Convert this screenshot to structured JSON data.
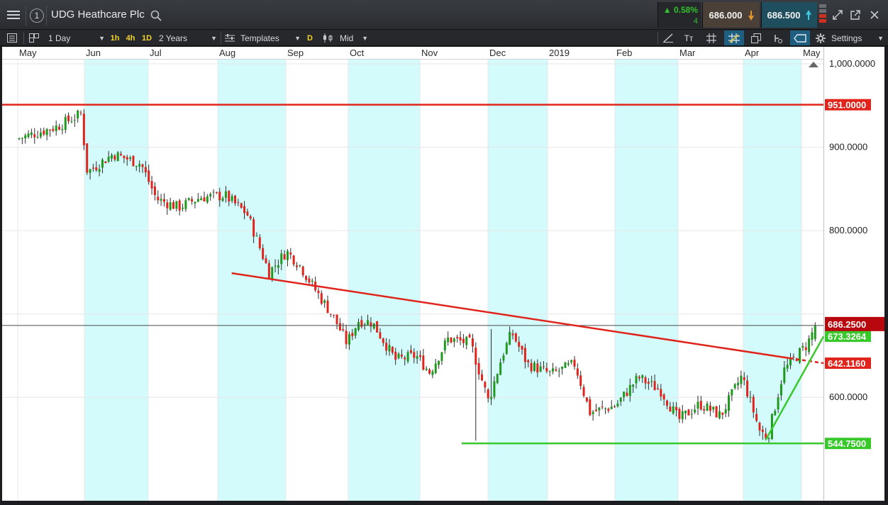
{
  "titlebar": {
    "menu_icon": "hamburger-icon",
    "window_number": "1",
    "title": "UDG Heathcare Plc",
    "search_icon": "search-icon",
    "change_pct": "▲ 0.58%",
    "change_sub": "4",
    "sell_price": "686.000",
    "buy_price": "686.500",
    "sell_arrow_icon": "arrow-down-icon",
    "buy_arrow_icon": "arrow-up-icon"
  },
  "toolbar": {
    "interval": "1 Day",
    "tf_1h": "1h",
    "tf_4h": "4h",
    "tf_1d": "1D",
    "range": "2 Years",
    "templates": "Templates",
    "d_badge": "D",
    "price_type": "Mid",
    "settings": "Settings",
    "text_tool": "Tт"
  },
  "colors": {
    "resistance": "#e0241b",
    "support": "#37c92a",
    "bull_candle": "#1f9a1f",
    "bear_candle": "#e0241b",
    "band": "#d4fbfb",
    "current_price_bg": "#b8070d"
  },
  "chart_data": {
    "type": "candlestick",
    "x_axis_labels": [
      "May",
      "Jun",
      "Jul",
      "Aug",
      "Sep",
      "Oct",
      "Nov",
      "Dec",
      "2019",
      "Feb",
      "Mar",
      "Apr",
      "May"
    ],
    "y_axis_ticks": [
      "1,000.0000",
      "900.0000",
      "800.0000",
      "600.0000"
    ],
    "ylim": [
      476,
      1006
    ],
    "price_labels": {
      "current": "686.2500",
      "trendline_up": "673.3264",
      "trendline_down": "642.1160",
      "resistance": "951.0000",
      "support": "544.7500"
    },
    "levels": {
      "resistance": 951,
      "support": 544.75,
      "current": 686.25
    },
    "trendline_down_points": [
      [
        "Aug",
        749
      ],
      [
        "Apr",
        647
      ],
      [
        "May",
        641
      ]
    ],
    "trendline_up_points": [
      [
        "Apr",
        549
      ],
      [
        "May",
        673
      ]
    ],
    "price_path": [
      [
        "2018-05-01",
        910
      ],
      [
        "2018-05-20",
        925
      ],
      [
        "2018-05-31",
        940
      ],
      [
        "2018-06-03",
        870
      ],
      [
        "2018-06-15",
        892
      ],
      [
        "2018-06-28",
        880
      ],
      [
        "2018-07-05",
        838
      ],
      [
        "2018-07-15",
        828
      ],
      [
        "2018-07-25",
        840
      ],
      [
        "2018-08-05",
        842
      ],
      [
        "2018-08-15",
        820
      ],
      [
        "2018-08-25",
        750
      ],
      [
        "2018-09-02",
        775
      ],
      [
        "2018-09-08",
        760
      ],
      [
        "2018-09-15",
        732
      ],
      [
        "2018-09-25",
        695
      ],
      [
        "2018-10-01",
        665
      ],
      [
        "2018-10-06",
        692
      ],
      [
        "2018-10-12",
        690
      ],
      [
        "2018-10-22",
        645
      ],
      [
        "2018-10-31",
        650
      ],
      [
        "2018-11-06",
        630
      ],
      [
        "2018-11-14",
        670
      ],
      [
        "2018-11-24",
        665
      ],
      [
        "2018-12-02",
        595
      ],
      [
        "2018-12-09",
        650
      ],
      [
        "2018-12-14",
        678
      ],
      [
        "2018-12-22",
        640
      ],
      [
        "2019-01-03",
        628
      ],
      [
        "2019-01-14",
        640
      ],
      [
        "2019-01-21",
        582
      ],
      [
        "2019-02-02",
        590
      ],
      [
        "2019-02-12",
        624
      ],
      [
        "2019-02-22",
        608
      ],
      [
        "2019-03-02",
        573
      ],
      [
        "2019-03-12",
        592
      ],
      [
        "2019-03-22",
        578
      ],
      [
        "2019-04-01",
        626
      ],
      [
        "2019-04-10",
        560
      ],
      [
        "2019-04-14",
        552
      ],
      [
        "2019-04-22",
        632
      ],
      [
        "2019-05-04",
        664
      ],
      [
        "2019-05-08",
        686
      ]
    ]
  }
}
